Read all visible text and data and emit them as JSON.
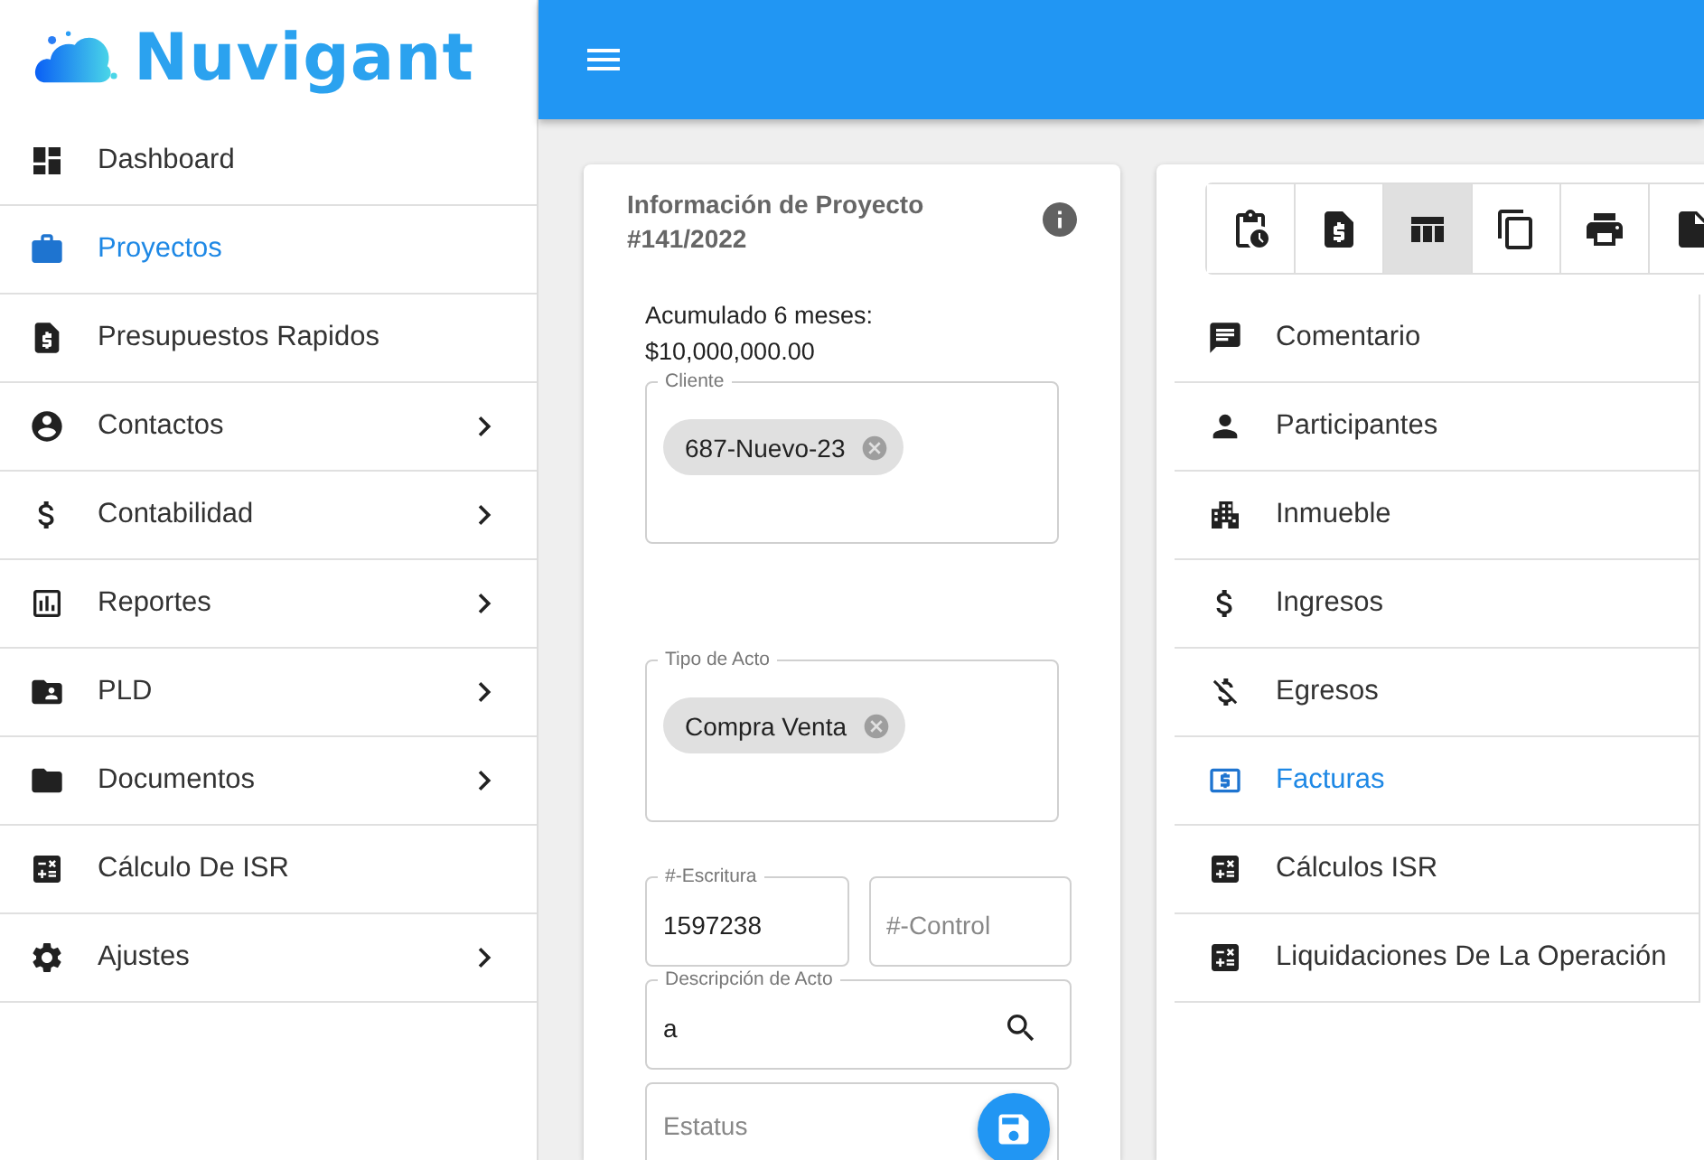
{
  "logo": {
    "text": "Nuvigant"
  },
  "sidebar": {
    "items": [
      {
        "label": "Dashboard",
        "selected": false,
        "has_submenu": false
      },
      {
        "label": "Proyectos",
        "selected": true,
        "has_submenu": false
      },
      {
        "label": "Presupuestos Rapidos",
        "selected": false,
        "has_submenu": false
      },
      {
        "label": "Contactos",
        "selected": false,
        "has_submenu": true
      },
      {
        "label": "Contabilidad",
        "selected": false,
        "has_submenu": true
      },
      {
        "label": "Reportes",
        "selected": false,
        "has_submenu": true
      },
      {
        "label": "PLD",
        "selected": false,
        "has_submenu": true
      },
      {
        "label": "Documentos",
        "selected": false,
        "has_submenu": true
      },
      {
        "label": "Cálculo De ISR",
        "selected": false,
        "has_submenu": false
      },
      {
        "label": "Ajustes",
        "selected": false,
        "has_submenu": true
      }
    ]
  },
  "project_card": {
    "title": "Información de Proyecto #141/2022",
    "accumulated": [
      "Acumulado 6 meses:",
      "$10,000,000.00"
    ],
    "fields": [
      {
        "kind": "chips",
        "label": "Cliente",
        "chips": [
          "687-Nuevo-23"
        ]
      },
      {
        "kind": "chips",
        "label": "Tipo de Acto",
        "chips": [
          "Compra Venta"
        ]
      },
      {
        "kind": "pair",
        "items": [
          {
            "label": "#-Escritura",
            "value": "1597238"
          },
          {
            "placeholder": "#-Control"
          }
        ]
      },
      {
        "kind": "search",
        "label": "Descripción de Acto",
        "value": "a"
      },
      {
        "kind": "text",
        "placeholder": "Estatus"
      }
    ]
  },
  "section_card": {
    "toolbar": [
      {
        "selected": false
      },
      {
        "selected": false
      },
      {
        "selected": true
      },
      {
        "selected": false
      },
      {
        "selected": false
      },
      {
        "selected": false
      }
    ],
    "items": [
      {
        "label": "Comentario",
        "selected": false
      },
      {
        "label": "Participantes",
        "selected": false
      },
      {
        "label": "Inmueble",
        "selected": false
      },
      {
        "label": "Ingresos",
        "selected": false
      },
      {
        "label": "Egresos",
        "selected": false
      },
      {
        "label": "Facturas",
        "selected": true
      },
      {
        "label": "Cálculos ISR",
        "selected": false
      },
      {
        "label": "Liquidaciones De La Operación",
        "selected": false
      }
    ]
  }
}
